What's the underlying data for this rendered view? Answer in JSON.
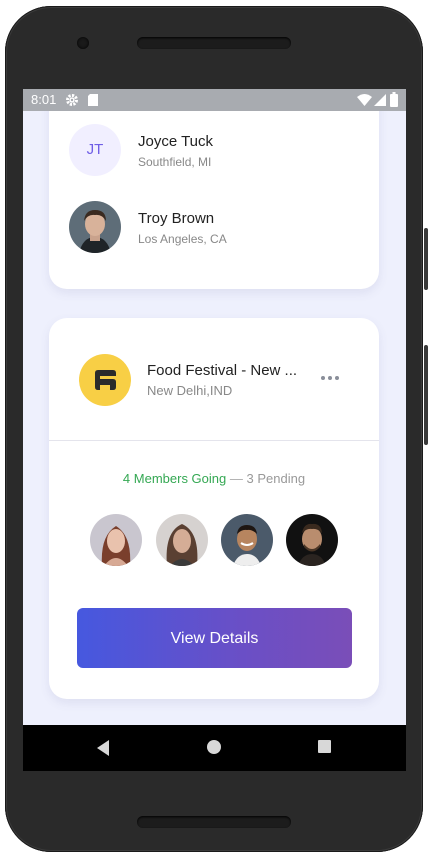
{
  "statusbar": {
    "time": "8:01",
    "icons": [
      "gear-icon",
      "sd-card-icon",
      "wifi-icon",
      "signal-icon",
      "battery-icon"
    ]
  },
  "people": [
    {
      "initials": "JT",
      "name": "Joyce Tuck",
      "location": "Southfield, MI"
    },
    {
      "name": "Troy Brown",
      "location": "Los Angeles, CA"
    }
  ],
  "event": {
    "title": "Food Festival - New ...",
    "subtitle": "New Delhi,IND",
    "members_going": "4 Members Going",
    "separator": "—",
    "pending": "3 Pending",
    "button_label": "View Details"
  },
  "colors": {
    "accent_start": "#4658df",
    "accent_end": "#7a4eb8",
    "going_green": "#34a853",
    "logo_yellow": "#f8cf45",
    "app_background": "#eef0fd"
  },
  "navigation": [
    "back-icon",
    "home-icon",
    "recents-icon"
  ]
}
